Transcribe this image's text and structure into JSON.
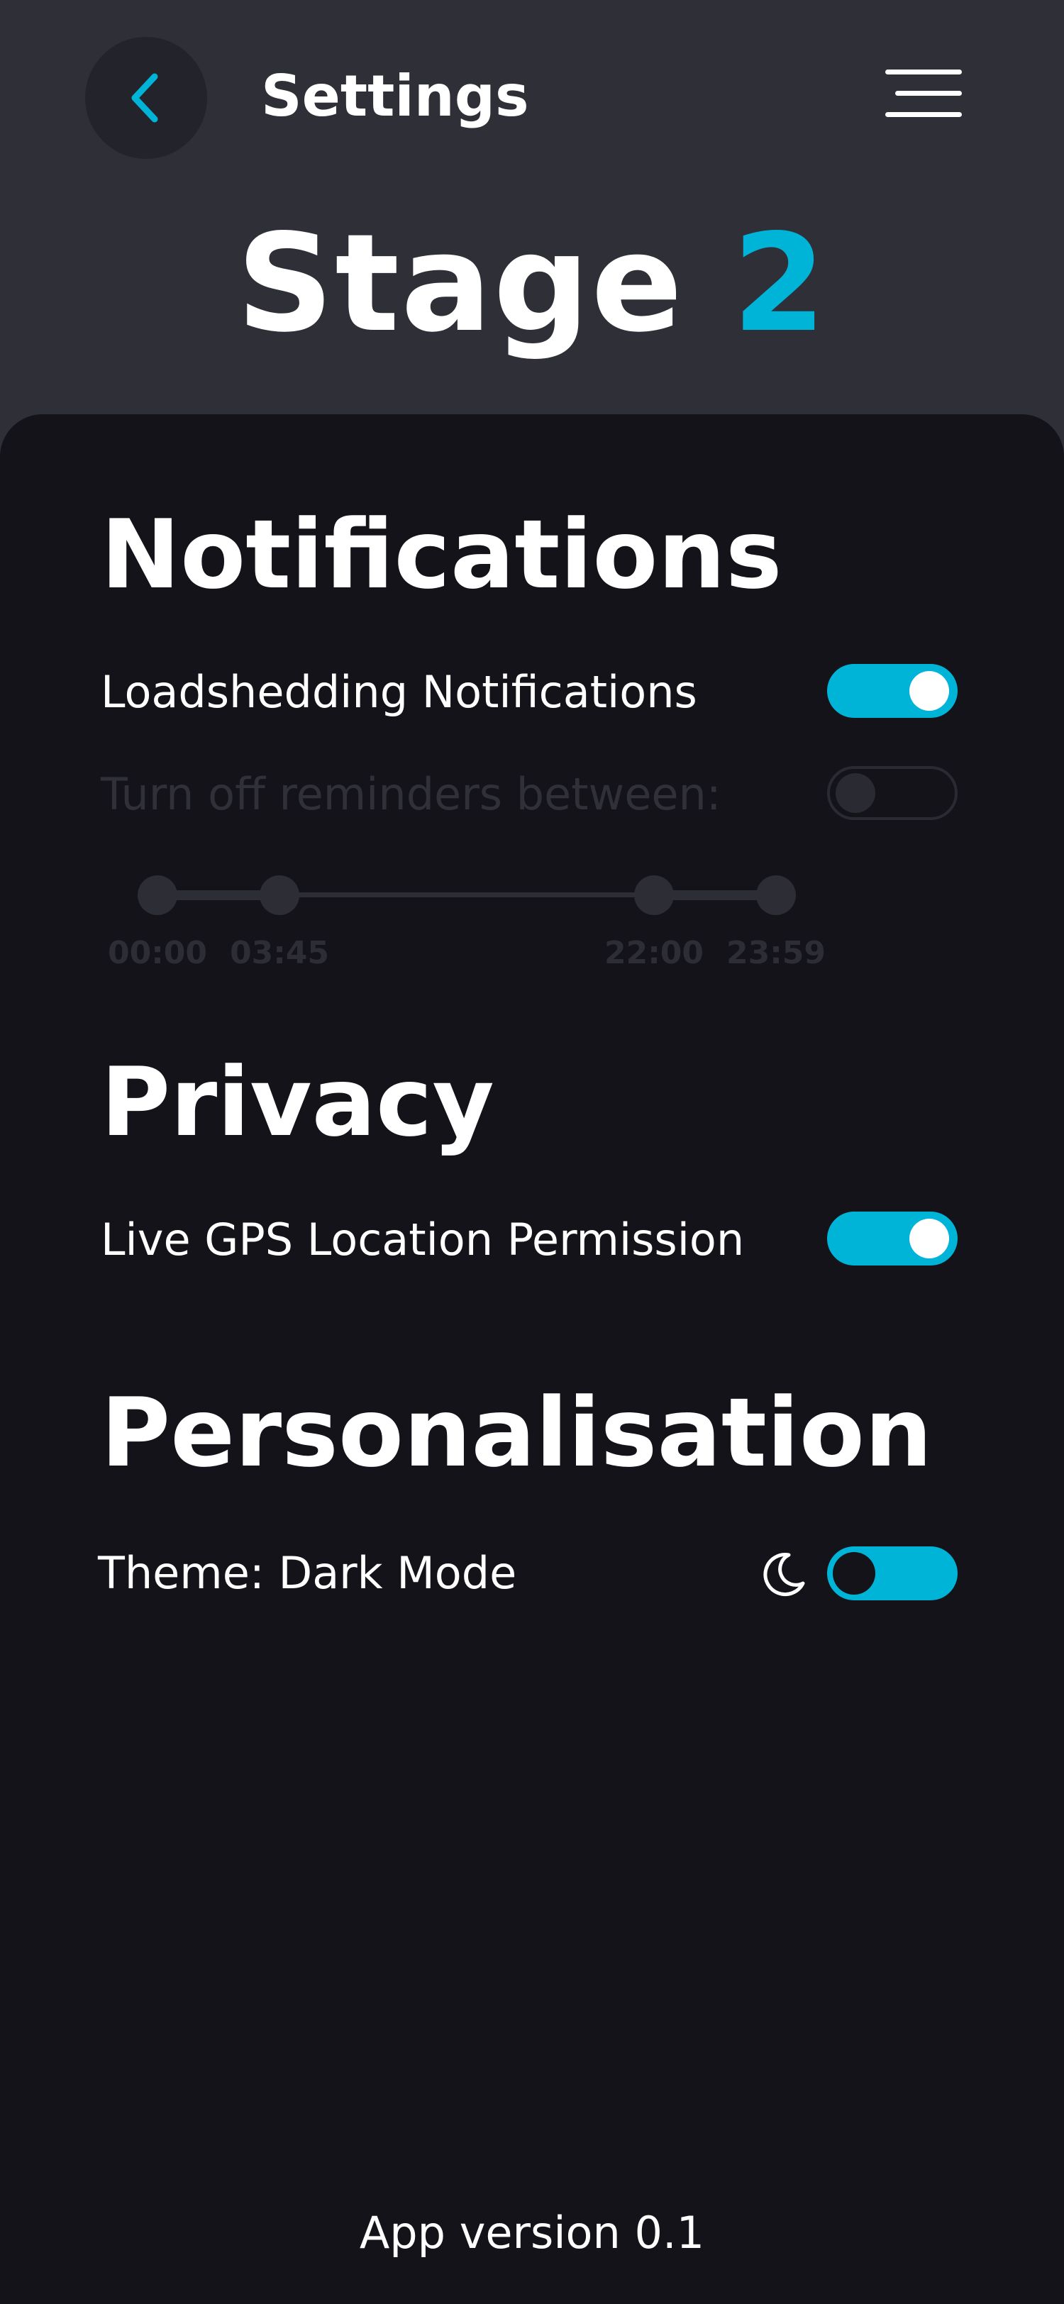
{
  "header": {
    "title": "Settings",
    "back_icon": "chevron-left-icon",
    "menu_icon": "hamburger-menu-icon"
  },
  "stage": {
    "label": "Stage",
    "number": "2"
  },
  "notifications": {
    "title": "Notifications",
    "loadshedding_label": "Loadshedding Notifications",
    "loadshedding_enabled": true,
    "reminders_label": "Turn off reminders between:",
    "reminders_enabled": false,
    "time_range": {
      "labels": [
        "00:00",
        "03:45",
        "22:00",
        "23:59"
      ]
    }
  },
  "privacy": {
    "title": "Privacy",
    "gps_label": "Live GPS Location Permission",
    "gps_enabled": true
  },
  "personalisation": {
    "title": "Personalisation",
    "theme_label": "Theme: Dark Mode",
    "theme_icon": "moon-icon",
    "dark_mode_enabled": true
  },
  "footer": {
    "version": "App version 0.1"
  },
  "colors": {
    "accent": "#00b4d8",
    "header_bg": "#2e2f37",
    "panel_bg": "#131319",
    "disabled": "#2d2e35"
  }
}
